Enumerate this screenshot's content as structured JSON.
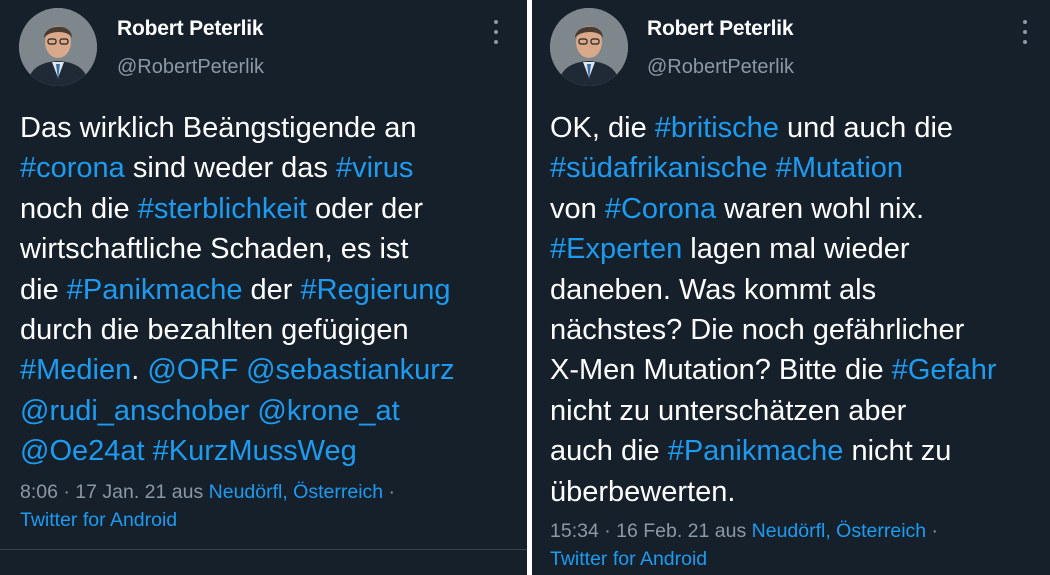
{
  "left": {
    "name": "Robert Peterlik",
    "handle": "@RobertPeterlik",
    "tweet_lines": [
      [
        {
          "t": "Das wirklich Beängstigende an",
          "h": false
        }
      ],
      [
        {
          "t": "#corona",
          "h": true
        },
        {
          "t": " sind weder das ",
          "h": false
        },
        {
          "t": "#virus",
          "h": true
        }
      ],
      [
        {
          "t": "noch die ",
          "h": false
        },
        {
          "t": "#sterblichkeit",
          "h": true
        },
        {
          "t": " oder der",
          "h": false
        }
      ],
      [
        {
          "t": "wirtschaftliche Schaden, es ist",
          "h": false
        }
      ],
      [
        {
          "t": "die ",
          "h": false
        },
        {
          "t": "#Panikmache",
          "h": true
        },
        {
          "t": " der ",
          "h": false
        },
        {
          "t": "#Regierung",
          "h": true
        }
      ],
      [
        {
          "t": "durch die bezahlten gefügigen",
          "h": false
        }
      ],
      [
        {
          "t": "#Medien",
          "h": true
        },
        {
          "t": ". ",
          "h": false
        },
        {
          "t": "@ORF",
          "h": true
        },
        {
          "t": " ",
          "h": false
        },
        {
          "t": "@sebastiankurz",
          "h": true
        }
      ],
      [
        {
          "t": "@rudi_anschober",
          "h": true
        },
        {
          "t": " ",
          "h": false
        },
        {
          "t": "@krone_at",
          "h": true
        }
      ],
      [
        {
          "t": "@Oe24at",
          "h": true
        },
        {
          "t": " ",
          "h": false
        },
        {
          "t": "#KurzMussWeg",
          "h": true
        }
      ]
    ],
    "meta_time": "8:06 · 17 Jan. 21 aus ",
    "meta_location": "Neudörfl, Österreich",
    "meta_sep": " ·",
    "meta_client": "Twitter for Android"
  },
  "right": {
    "name": "Robert Peterlik",
    "handle": "@RobertPeterlik",
    "tweet_lines": [
      [
        {
          "t": "OK, die ",
          "h": false
        },
        {
          "t": "#britische",
          "h": true
        },
        {
          "t": " und auch die",
          "h": false
        }
      ],
      [
        {
          "t": "#südafrikanische",
          "h": true
        },
        {
          "t": " ",
          "h": false
        },
        {
          "t": "#Mutation",
          "h": true
        }
      ],
      [
        {
          "t": "von ",
          "h": false
        },
        {
          "t": "#Corona",
          "h": true
        },
        {
          "t": " waren wohl nix.",
          "h": false
        }
      ],
      [
        {
          "t": "#Experten",
          "h": true
        },
        {
          "t": " lagen mal wieder",
          "h": false
        }
      ],
      [
        {
          "t": "daneben. Was kommt als",
          "h": false
        }
      ],
      [
        {
          "t": "nächstes? Die noch gefährlicher",
          "h": false
        }
      ],
      [
        {
          "t": "X-Men Mutation? Bitte die ",
          "h": false
        },
        {
          "t": "#Gefahr",
          "h": true
        }
      ],
      [
        {
          "t": "nicht zu unterschätzen aber",
          "h": false
        }
      ],
      [
        {
          "t": "auch die ",
          "h": false
        },
        {
          "t": "#Panikmache",
          "h": true
        },
        {
          "t": " nicht zu",
          "h": false
        }
      ],
      [
        {
          "t": "überbewerten.",
          "h": false
        }
      ]
    ],
    "meta_time": "15:34 · 16 Feb. 21 aus ",
    "meta_location": "Neudörfl, Österreich",
    "meta_sep": " ·",
    "meta_client": "Twitter for Android"
  },
  "icons": {
    "more": "more-vertical-icon",
    "avatar": "profile-photo"
  },
  "colors": {
    "background": "#15202b",
    "text": "#ffffff",
    "secondary": "#8b98a5",
    "link": "#1d9bf0"
  }
}
